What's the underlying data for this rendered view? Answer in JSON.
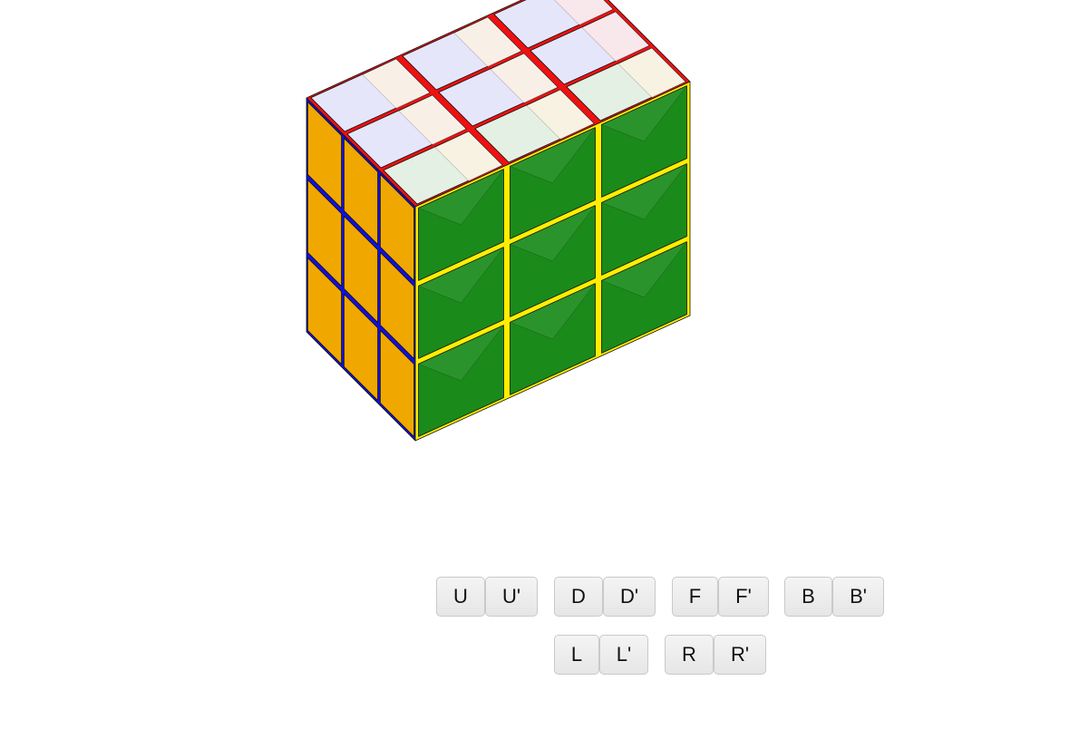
{
  "cube": {
    "colors": {
      "top": "#e6e6fb",
      "front_fill": "#1a8a1a",
      "front_top": "#e4f0e4",
      "left_fill": "#f0a800",
      "sticker_gap_yellow": "#ffee00",
      "sticker_gap_red": "#ee1111",
      "sticker_gap_blue": "#1010dd",
      "sticker_gap_green": "#1a8a1a",
      "highlight_cream": "#fdf3e3",
      "highlight_pink": "#fde8e8"
    }
  },
  "controls": {
    "row1": [
      {
        "label": "U"
      },
      {
        "label": "U'"
      },
      {
        "label": "D"
      },
      {
        "label": "D'"
      },
      {
        "label": "F"
      },
      {
        "label": "F'"
      },
      {
        "label": "B"
      },
      {
        "label": "B'"
      }
    ],
    "row2": [
      {
        "label": "L"
      },
      {
        "label": "L'"
      },
      {
        "label": "R"
      },
      {
        "label": "R'"
      }
    ]
  }
}
